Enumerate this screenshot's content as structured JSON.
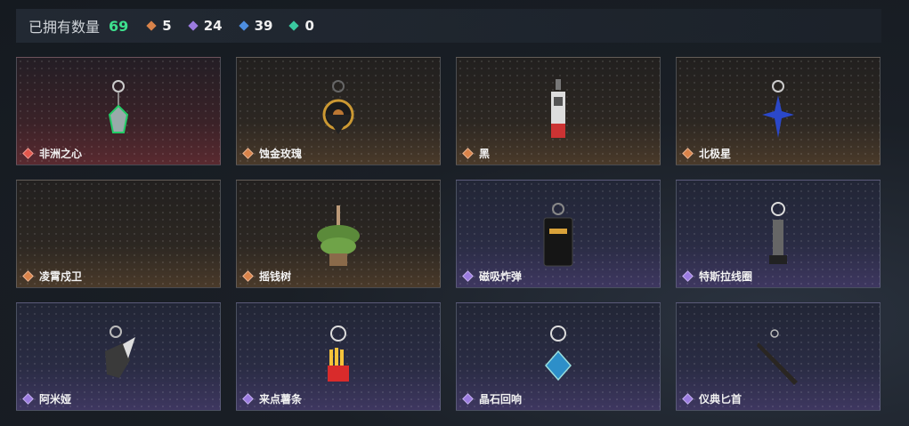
{
  "header": {
    "title": "已拥有数量",
    "total": "69",
    "stats": [
      {
        "icon": "orange-diamond-icon",
        "color": "#d9834a",
        "value": "5"
      },
      {
        "icon": "purple-diamond-icon",
        "color": "#9b7be0",
        "value": "24"
      },
      {
        "icon": "blue-diamond-icon",
        "color": "#4d8ee0",
        "value": "39"
      },
      {
        "icon": "green-diamond-icon",
        "color": "#3ac9a0",
        "value": "0"
      }
    ]
  },
  "items": [
    {
      "name": "非洲之心",
      "rarity": "red",
      "art": "heart-charm-icon"
    },
    {
      "name": "蚀金玫瑰",
      "rarity": "orange",
      "art": "gold-rose-charm-icon"
    },
    {
      "name": "黑",
      "rarity": "orange",
      "art": "black-tag-charm-icon"
    },
    {
      "name": "北极星",
      "rarity": "orange",
      "art": "polaris-star-charm-icon"
    },
    {
      "name": "凌霄戍卫",
      "rarity": "orange",
      "art": "guard-charm-icon"
    },
    {
      "name": "摇钱树",
      "rarity": "orange",
      "art": "money-tree-charm-icon"
    },
    {
      "name": "磁吸炸弹",
      "rarity": "purple",
      "art": "magnetic-bomb-charm-icon"
    },
    {
      "name": "特斯拉线圈",
      "rarity": "purple",
      "art": "tesla-coil-charm-icon"
    },
    {
      "name": "阿米娅",
      "rarity": "purple",
      "art": "amiya-charm-icon"
    },
    {
      "name": "来点薯条",
      "rarity": "purple",
      "art": "fries-charm-icon"
    },
    {
      "name": "晶石回响",
      "rarity": "purple",
      "art": "crystal-echo-charm-icon"
    },
    {
      "name": "仪典匕首",
      "rarity": "purple",
      "art": "ritual-dagger-charm-icon"
    }
  ]
}
